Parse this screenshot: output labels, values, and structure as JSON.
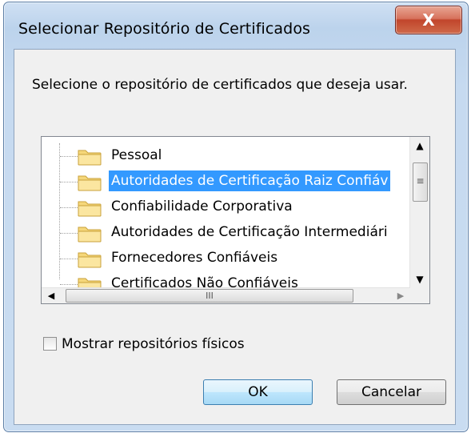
{
  "window": {
    "title": "Selecionar Repositório de Certificados",
    "close_label": "X"
  },
  "prompt_text": "Selecione o repositório de certificados que deseja usar.",
  "tree": {
    "items": [
      {
        "label": "Pessoal",
        "selected": false,
        "icon": "folder-icon"
      },
      {
        "label": "Autoridades de Certificação Raiz Confiáv",
        "selected": true,
        "icon": "folder-icon"
      },
      {
        "label": "Confiabilidade Corporativa",
        "selected": false,
        "icon": "folder-icon"
      },
      {
        "label": "Autoridades de Certificação Intermediári",
        "selected": false,
        "icon": "folder-icon"
      },
      {
        "label": "Fornecedores Confiáveis",
        "selected": false,
        "icon": "folder-icon"
      },
      {
        "label": "Certificados Não Confiáveis",
        "selected": false,
        "icon": "folder-icon"
      }
    ]
  },
  "scrollbar": {
    "up_glyph": "▲",
    "down_glyph": "▼",
    "left_glyph": "◀",
    "right_glyph": "▶",
    "vthumb_grip": "≡",
    "hthumb_grip": "III"
  },
  "checkbox": {
    "label": "Mostrar repositórios físicos",
    "checked": false
  },
  "buttons": {
    "ok_label": "OK",
    "cancel_label": "Cancelar"
  },
  "colors": {
    "selection": "#3399ff",
    "close_button": "#c1452b",
    "folder": "#f5d77a"
  }
}
